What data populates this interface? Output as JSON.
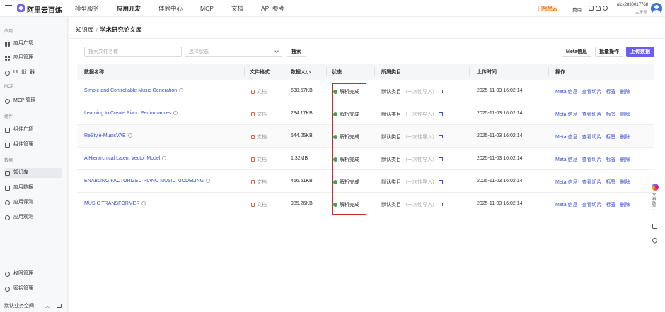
{
  "topbar": {
    "logo": "阿里云百炼",
    "nav": [
      "模型服务",
      "应用开发",
      "体验中心",
      "MCP",
      "文档",
      "API 参考"
    ],
    "active_nav": "应用开发",
    "brand_tag": "[-]阿里云",
    "fee": "费用",
    "user_name": "nick2830017768",
    "user_role": "主账号"
  },
  "sidebar": {
    "sections": {
      "app": "应用",
      "mcp": "MCP",
      "component": "组件",
      "data": "数据"
    },
    "items": {
      "app_plaza": "应用广场",
      "app_manage": "应用管理",
      "ui_designer": "UI 设计器",
      "mcp_manage": "MCP 管理",
      "comp_plaza": "组件广场",
      "comp_manage": "组件管理",
      "knowledge": "知识库",
      "app_data": "应用数据",
      "app_eval": "应用评测",
      "app_watch": "应用观测",
      "permission": "权限管理",
      "keys": "密钥管理"
    },
    "workspace": "默认业务空间"
  },
  "breadcrumb": {
    "root": "知识库",
    "sep": "/",
    "current": "学术研究论文库"
  },
  "toolbar": {
    "search_placeholder": "搜索文件名称",
    "status_placeholder": "选择状态",
    "search_button": "搜索",
    "meta_button": "Meta信息",
    "batch_button": "批量操作",
    "upload_button": "上传数据"
  },
  "table": {
    "headers": [
      "数据名称",
      "文件格式",
      "数据大小",
      "状态",
      "所属类目",
      "上传时间",
      "操作"
    ],
    "rows": [
      {
        "name": "Simple and Controllable Music Generation",
        "format": "文档",
        "size": "638.57KB",
        "status": "解析完成",
        "category": "默认类目",
        "category_note": "（一次性导入）",
        "time": "2025-11-03 16:02:14"
      },
      {
        "name": "Learning to Create Piano Performances",
        "format": "文档",
        "size": "234.17KB",
        "status": "解析完成",
        "category": "默认类目",
        "category_note": "（一次性导入）",
        "time": "2025-11-03 16:02:14"
      },
      {
        "name": "ReStyle-MusicVAE",
        "format": "文档",
        "size": "544.05KB",
        "status": "解析完成",
        "category": "默认类目",
        "category_note": "（一次性导入）",
        "time": "2025-11-03 16:02:14"
      },
      {
        "name": "A Hierarchical Latent Vector Model",
        "format": "文档",
        "size": "1.32MB",
        "status": "解析完成",
        "category": "默认类目",
        "category_note": "（一次性导入）",
        "time": "2025-11-03 16:02:14"
      },
      {
        "name": "ENABLING FACTORIZED PIANO MUSIC MODELING",
        "format": "文档",
        "size": "466.51KB",
        "status": "解析完成",
        "category": "默认类目",
        "category_note": "（一次性导入）",
        "time": "2025-11-03 16:02:14"
      },
      {
        "name": "MUSIC TRANSFORMER",
        "format": "文档",
        "size": "985.26KB",
        "status": "解析完成",
        "category": "默认类目",
        "category_note": "（一次性导入）",
        "time": "2025-11-03 16:02:14"
      }
    ],
    "actions": [
      "Meta 信息",
      "查看切片",
      "标签",
      "删除"
    ]
  },
  "floatbar": {
    "label": "文档助手"
  },
  "colors": {
    "primary": "#6a5cf6",
    "link": "#3a4fd4",
    "status_ok": "#2faa55",
    "highlight": "#d12a2a"
  }
}
